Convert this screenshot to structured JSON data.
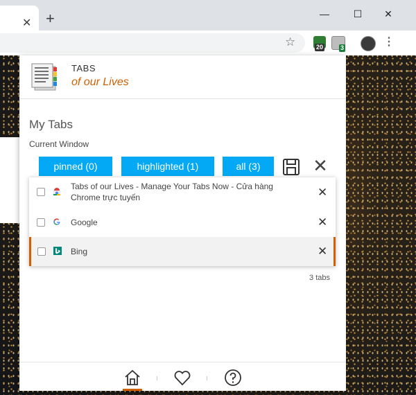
{
  "browser": {
    "tab_close": "✕",
    "new_tab": "+",
    "window_controls": {
      "minimize": "—",
      "maximize": "☐",
      "close": "✕"
    },
    "bookmark_icon": "star-icon",
    "extensions": [
      {
        "name": "shield-extension",
        "badge": "20",
        "color": "#2e7d32",
        "badge_color": "#333333"
      },
      {
        "name": "tabs-extension",
        "badge": "3",
        "color": "#9e9e9e",
        "badge_color": "#1b7f3b"
      }
    ],
    "menu_glyph": "⋮"
  },
  "popup": {
    "brand_top": "TABS",
    "brand_bottom": "of our Lives",
    "title": "My Tabs",
    "subtitle": "Current Window",
    "filters": [
      {
        "label": "pinned (0)"
      },
      {
        "label": "highlighted (1)"
      },
      {
        "label": "all (3)"
      }
    ],
    "tabs": [
      {
        "title": "Tabs of our Lives - Manage Your Tabs Now - Cửa hàng Chrome trực tuyến",
        "favicon": "chrome-webstore-icon",
        "active": false
      },
      {
        "title": "Google",
        "favicon": "google-icon",
        "active": false
      },
      {
        "title": "Bing",
        "favicon": "bing-icon",
        "active": true
      }
    ],
    "tab_count": "3 tabs",
    "footer": [
      "home-icon",
      "heart-icon",
      "help-icon"
    ],
    "accent": "#d35f00",
    "pill_color": "#03a9f4"
  }
}
